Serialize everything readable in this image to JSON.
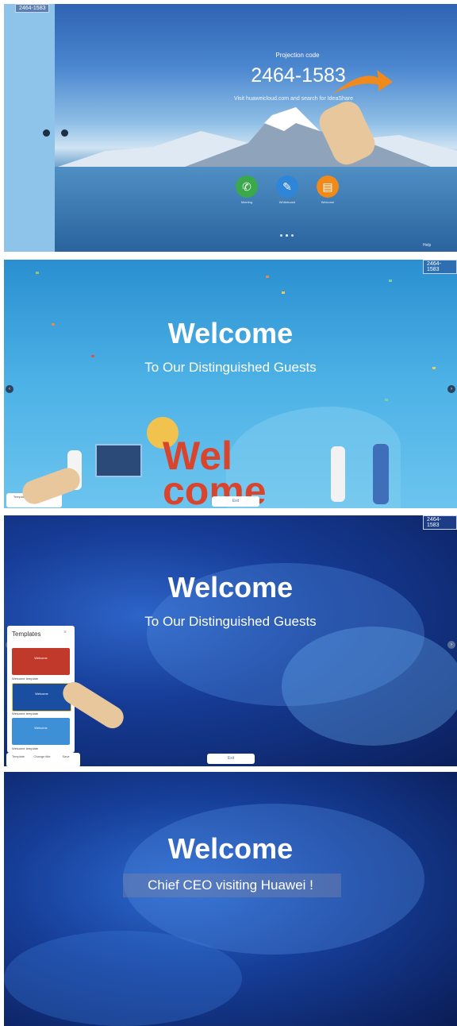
{
  "panel1": {
    "code_badge": "2464-1583",
    "projection_label": "Projection code",
    "projection_code": "2464-1583",
    "hint": "Visit huaweicloud.com and search for IdeaShare",
    "apps": [
      {
        "label": "Meeting",
        "color": "#3aa84b",
        "icon": "phone"
      },
      {
        "label": "Whiteboard",
        "color": "#2f86d8",
        "icon": "pen"
      },
      {
        "label": "Welcome",
        "color": "#ef8a1b",
        "icon": "welcome"
      }
    ],
    "bottom_right": "Help"
  },
  "panel2": {
    "code_badge": "2464-1583",
    "welcome": "Welcome",
    "subtitle": "To Our Distinguished Guests",
    "exit_label": "Exit",
    "tools": [
      "Template",
      "Edit"
    ]
  },
  "panel3": {
    "code_badge": "2464-1583",
    "welcome": "Welcome",
    "subtitle": "To Our Distinguished Guests",
    "templates_title": "Templates",
    "templates": [
      {
        "card_title": "Welcome",
        "name": "Welcome template",
        "color": "#c0392b"
      },
      {
        "card_title": "Welcome",
        "name": "Welcome template",
        "color": "#1a4ea0"
      },
      {
        "card_title": "Welcome",
        "name": "Welcome template",
        "color": "#3d8fd6"
      }
    ],
    "exit_label": "Exit",
    "tools": [
      "Template",
      "Change title",
      "Save"
    ]
  },
  "panel4": {
    "welcome": "Welcome",
    "subtitle": "Chief CEO visiting Huawei !"
  }
}
